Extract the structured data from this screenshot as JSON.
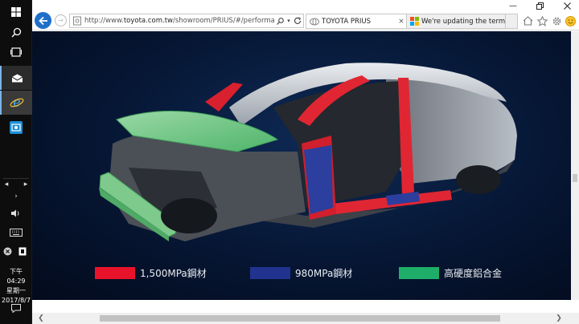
{
  "taskbar": {
    "clock": {
      "ampm_time": "下午 04:29",
      "weekday": "星期一",
      "date": "2017/8/7"
    }
  },
  "browser": {
    "address": {
      "scheme": "http://www.",
      "host": "toyota.com.tw",
      "path": "/showroom/PRIUS/#/performance"
    },
    "tabs": [
      {
        "label": "TOYOTA PRIUS",
        "active": true
      },
      {
        "label": "We're updating the terms a...",
        "active": false
      }
    ]
  },
  "legend": {
    "items": [
      {
        "label": "1,500MPa鋼材",
        "color": "#e8132b"
      },
      {
        "label": "980MPa鋼材",
        "color": "#20338f"
      },
      {
        "label": "高硬度鋁合金",
        "color": "#1fae69"
      }
    ]
  },
  "colors": {
    "accent": "#1e6fc9",
    "page_bg": "#061633"
  }
}
